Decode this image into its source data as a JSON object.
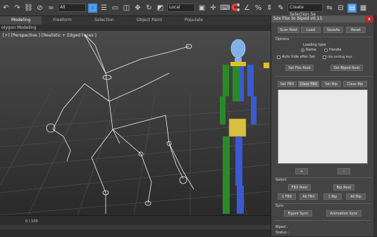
{
  "toolbar": {
    "filter_select": "All",
    "coord_select": "Local",
    "selection_set": "Create Selection Se"
  },
  "ribbon": {
    "tabs": [
      "Modeling",
      "Freeform",
      "Selection",
      "Object Paint",
      "Populate"
    ],
    "active_tab": "Modeling",
    "subtitle": "olygon Modeling"
  },
  "viewport": {
    "label": "[+] [Perspective ] [Realistic + Edged Faces ]"
  },
  "timeline": {
    "counter": "0 / 100"
  },
  "panel": {
    "title": "Sox Fbx to Biped v0.15",
    "close": "x",
    "top_buttons": [
      "Scan Root",
      "Load",
      "SaveAs",
      "Reset"
    ],
    "options_label": "Options",
    "loading_type_label": "Loading type",
    "radio_name": "Name",
    "radio_handle": "Handle",
    "auto_hide_label": "Auto hide after Set",
    "use_existing_keys_label": "Use existing keys",
    "set_fbx_root": "Set Fbx Root",
    "set_biped_root": "Set Biped Root",
    "mid_buttons": [
      "Set FBX",
      "Clear FBX",
      "Set Bip",
      "Clear Bip"
    ],
    "plus": "+",
    "minus": "-",
    "select_label": "Select",
    "fbx_root_button": "FBX Root",
    "bip_root_button": "Bip Root",
    "select_buttons": [
      "1 FBX",
      "All FBX",
      "1 Bip",
      "All Bip"
    ],
    "sync_label": "Sync",
    "figure_sync": "Figure Sync",
    "animation_sync": "Animation Sync",
    "biped_label": "Biped :",
    "status_label": "Status :"
  }
}
